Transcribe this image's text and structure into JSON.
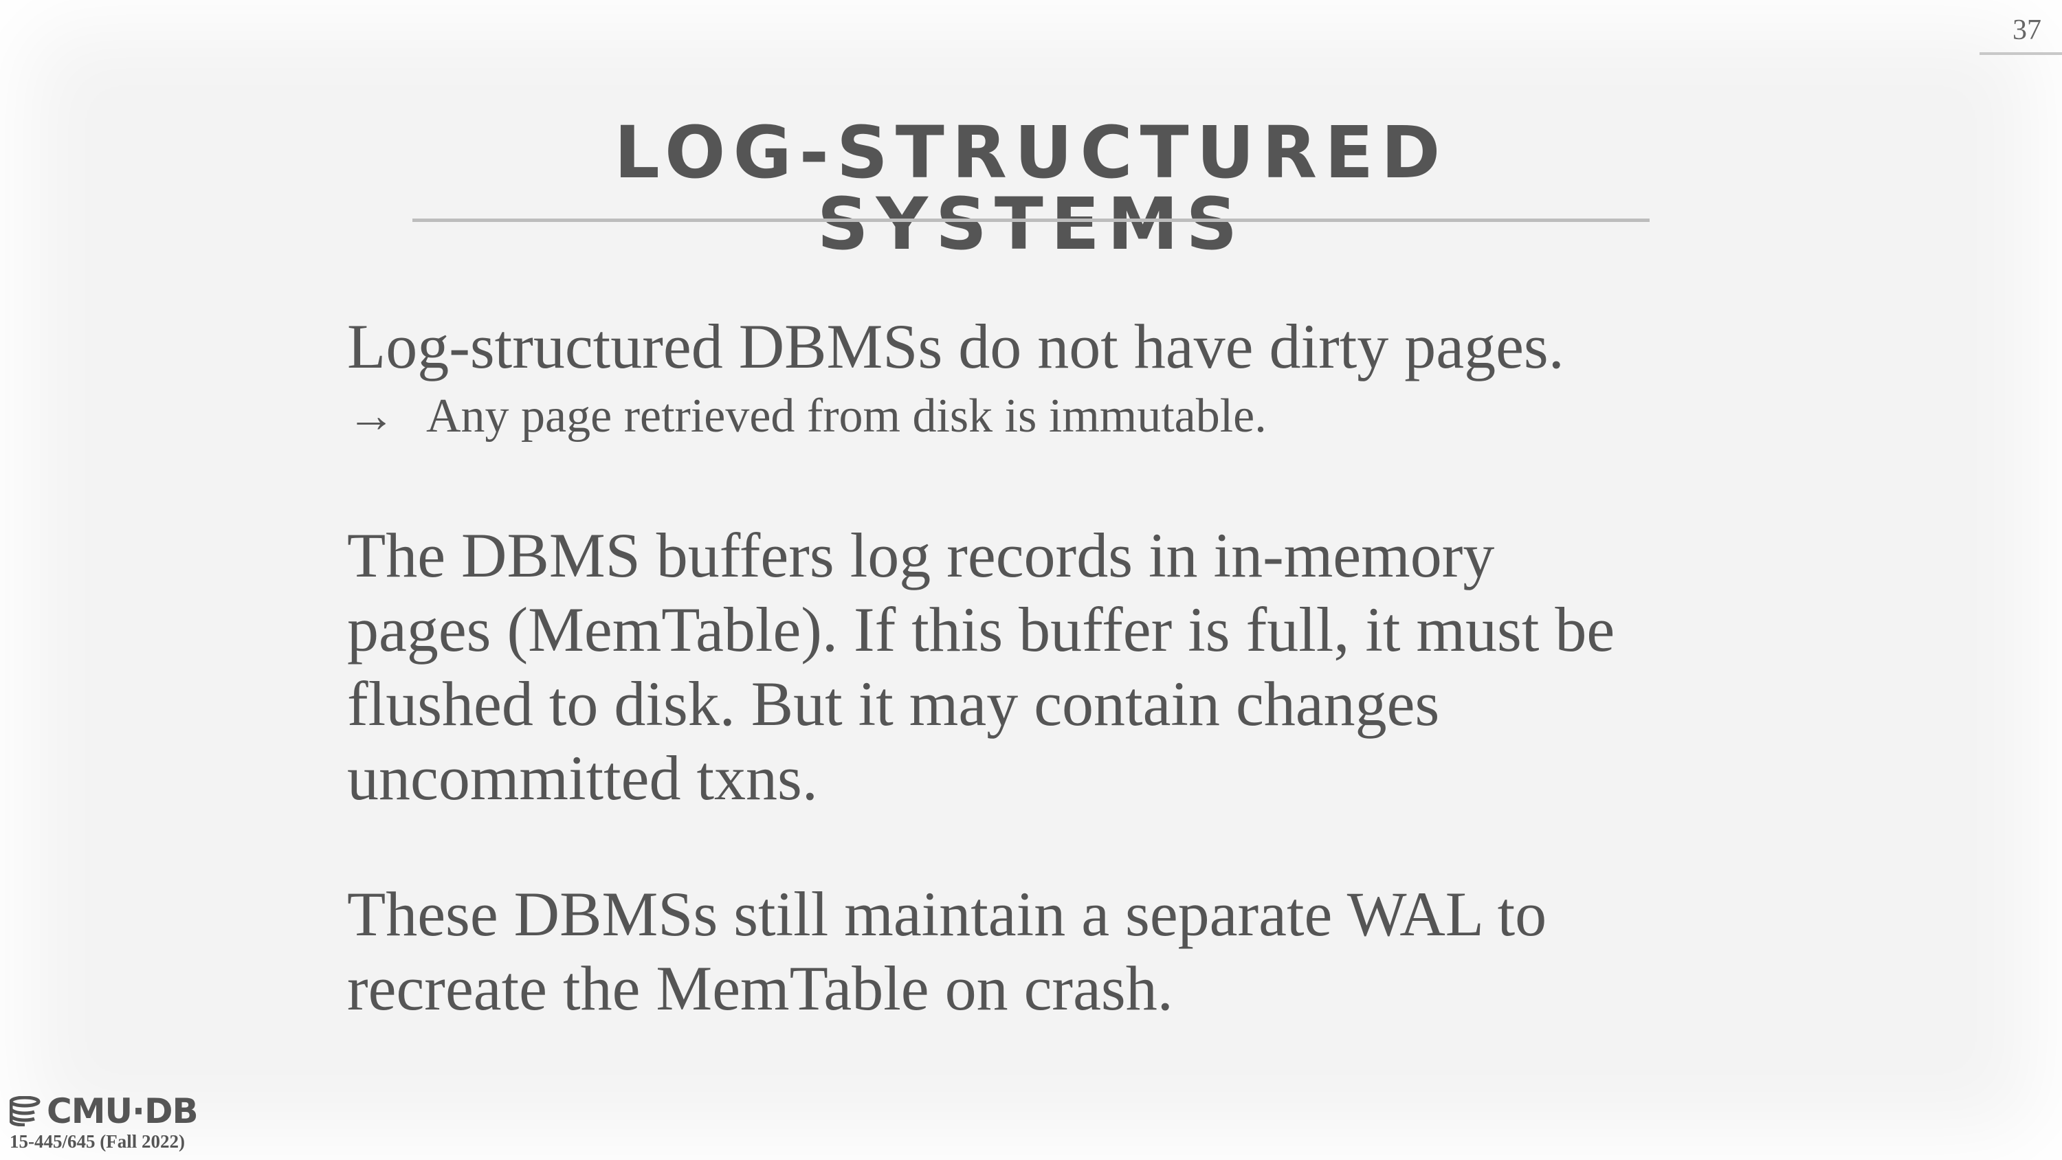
{
  "slide": {
    "page_number": "37",
    "title": "LOG-STRUCTURED SYSTEMS",
    "bullets": [
      {
        "text": "Log-structured DBMSs do not have dirty pages.",
        "sub": {
          "arrow": "→",
          "text": "Any page retrieved from disk is immutable."
        }
      },
      {
        "lines": [
          "The DBMS buffers log records in in-memory",
          "pages (MemTable). If this buffer is full, it must be",
          "flushed to disk. But it may contain changes",
          "uncommitted txns."
        ]
      },
      {
        "lines": [
          "These DBMSs still maintain a separate WAL to",
          "recreate the MemTable on crash."
        ]
      }
    ]
  },
  "footer": {
    "logo_text": "CMU·DB",
    "logo_icon": "database-icon",
    "course": "15-445/645 (Fall 2022)"
  }
}
